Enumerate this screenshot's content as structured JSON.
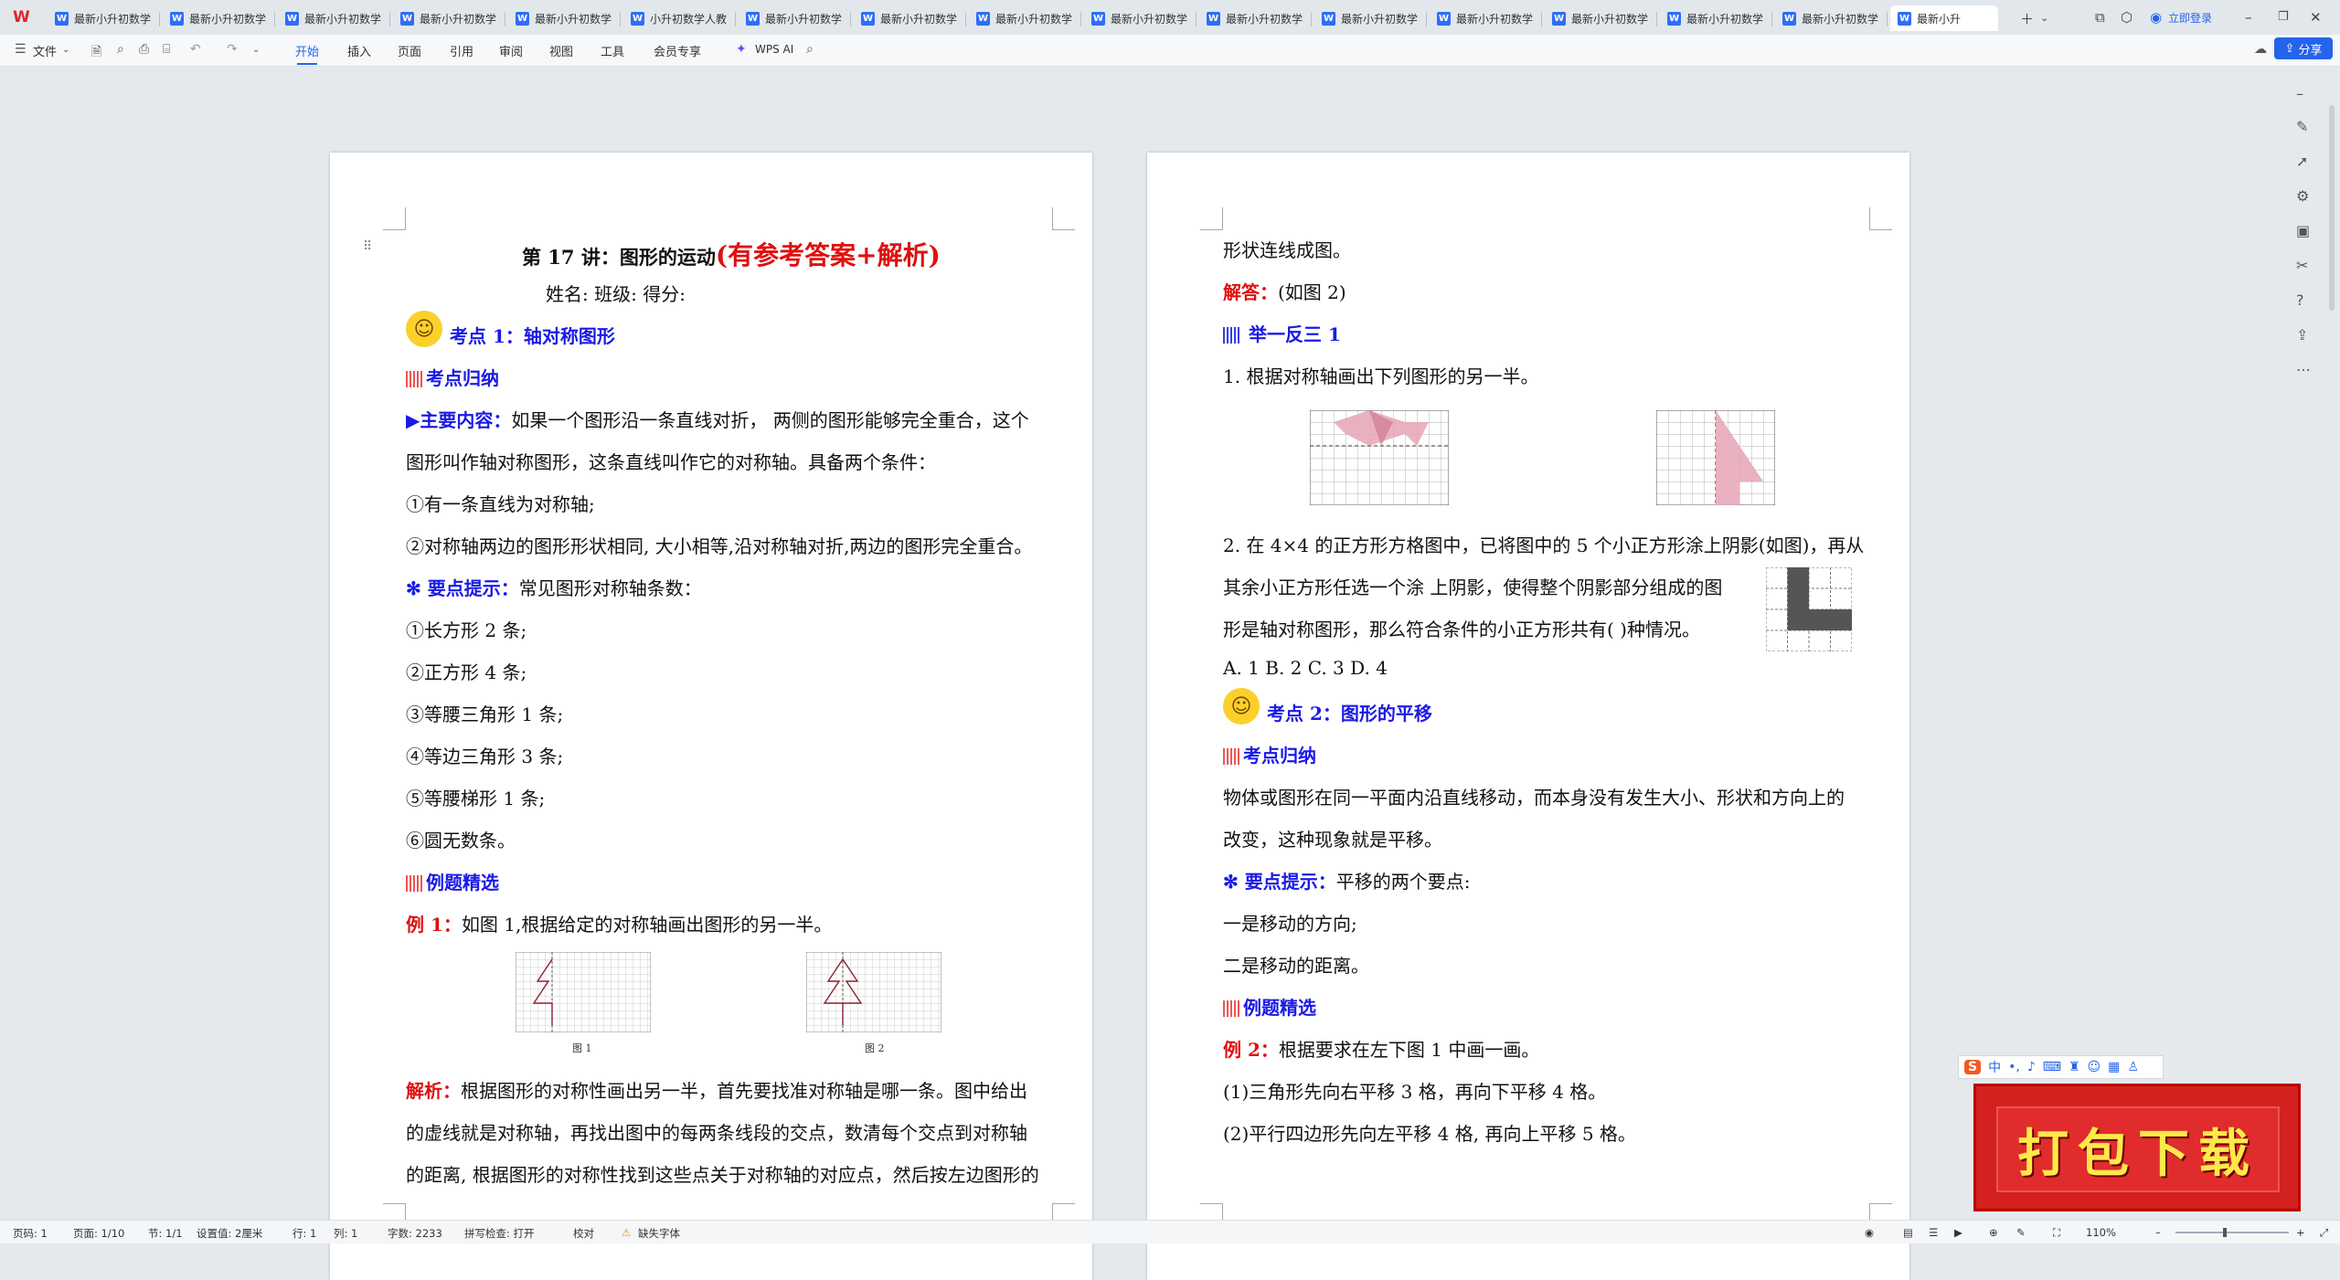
{
  "app": {
    "logo": "W"
  },
  "tabs": [
    {
      "title": "最新小升初数学"
    },
    {
      "title": "最新小升初数学"
    },
    {
      "title": "最新小升初数学"
    },
    {
      "title": "最新小升初数学"
    },
    {
      "title": "最新小升初数学"
    },
    {
      "title": "小升初数学人教"
    },
    {
      "title": "最新小升初数学"
    },
    {
      "title": "最新小升初数学"
    },
    {
      "title": "最新小升初数学"
    },
    {
      "title": "最新小升初数学"
    },
    {
      "title": "最新小升初数学"
    },
    {
      "title": "最新小升初数学"
    },
    {
      "title": "最新小升初数学"
    },
    {
      "title": "最新小升初数学"
    },
    {
      "title": "最新小升初数学"
    },
    {
      "title": "最新小升初数学"
    },
    {
      "title": "最新小升"
    }
  ],
  "titlebar": {
    "login": "立即登录"
  },
  "ribbon": {
    "file": "文件",
    "tabs": [
      "开始",
      "插入",
      "页面",
      "引用",
      "审阅",
      "视图",
      "工具",
      "会员专享"
    ],
    "wps_ai": "WPS AI",
    "share": "分享"
  },
  "page1": {
    "title_main": "第 17 讲：图形的运动",
    "title_suffix": "(有参考答案+解析)",
    "name_line": "姓名:                班级:                得分:",
    "kp1": "考点 1：轴对称图形",
    "kp_summary": "考点归纳",
    "main_label": "▶主要内容：",
    "main_text1": "如果一个图形沿一条直线对折， 两侧的图形能够完全重合，这个",
    "main_text2": "图形叫作轴对称图形，这条直线叫作它的对称轴。具备两个条件：",
    "cond1": "①有一条直线为对称轴;",
    "cond2": "②对称轴两边的图形形状相同, 大小相等,沿对称轴对折,两边的图形完全重合。",
    "tip_label": "✻ 要点提示：",
    "tip_text": "常见图形对称轴条数：",
    "list": [
      "①长方形 2 条;",
      "②正方形 4 条;",
      "③等腰三角形 1 条;",
      "④等边三角形 3 条;",
      "⑤等腰梯形 1 条;",
      "⑥圆无数条。"
    ],
    "examples": "例题精选",
    "ex1_label": "例 1：",
    "ex1_text": "如图 1,根据给定的对称轴画出图形的另一半。",
    "fig1_cap": "图 1",
    "fig2_cap": "图 2",
    "analysis_label": "解析：",
    "analysis1": "根据图形的对称性画出另一半，首先要找准对称轴是哪一条。图中给出",
    "analysis2": "的虚线就是对称轴，再找出图中的每两条线段的交点，数清每个交点到对称轴",
    "analysis3": "的距离, 根据图形的对称性找到这些点关于对称轴的对应点，然后按左边图形的"
  },
  "page2": {
    "cont": "形状连线成图。",
    "answer_label": "解答：",
    "answer_text": "(如图 2)",
    "practice": "举一反三 1",
    "q1": "1. 根据对称轴画出下列图形的另一半。",
    "q2a": "2. 在 4×4 的正方形方格图中，已将图中的 5 个小正方形涂上阴影(如图)，再从",
    "q2b": "其余小正方形任选一个涂  上阴影，使得整个阴影部分组成的图",
    "q2c": "形是轴对称图形，那么符合条件的小正方形共有(       )种情况。",
    "options": "A. 1       B. 2       C. 3       D. 4",
    "kp2": "考点 2：图形的平移",
    "kp_summary": "考点归纳",
    "body1": "物体或图形在同一平面内沿直线移动，而本身没有发生大小、形状和方向上的",
    "body2": "改变，这种现象就是平移。",
    "tip_label": "✻ 要点提示：",
    "tip_text": "平移的两个要点:",
    "pt1": "一是移动的方向;",
    "pt2": "二是移动的距离。",
    "examples": "例题精选",
    "ex2_label": "例 2：",
    "ex2_text": "根据要求在左下图 1 中画一画。",
    "ex2_1": "(1)三角形先向右平移 3 格，再向下平移 4 格。",
    "ex2_2": "(2)平行四边形先向左平移 4 格, 再向上平移 5 格。"
  },
  "ime": {
    "label": "中"
  },
  "promo": {
    "text": "打包下载"
  },
  "status": {
    "page": "页码: 1",
    "pages": "页面: 1/10",
    "section": "节: 1/1",
    "setting": "设置值: 2厘米",
    "row": "行: 1",
    "col": "列: 1",
    "words": "字数: 2233",
    "spell": "拼写检查: 打开",
    "proof": "校对",
    "font_missing": "缺失字体",
    "zoom": "110%"
  }
}
